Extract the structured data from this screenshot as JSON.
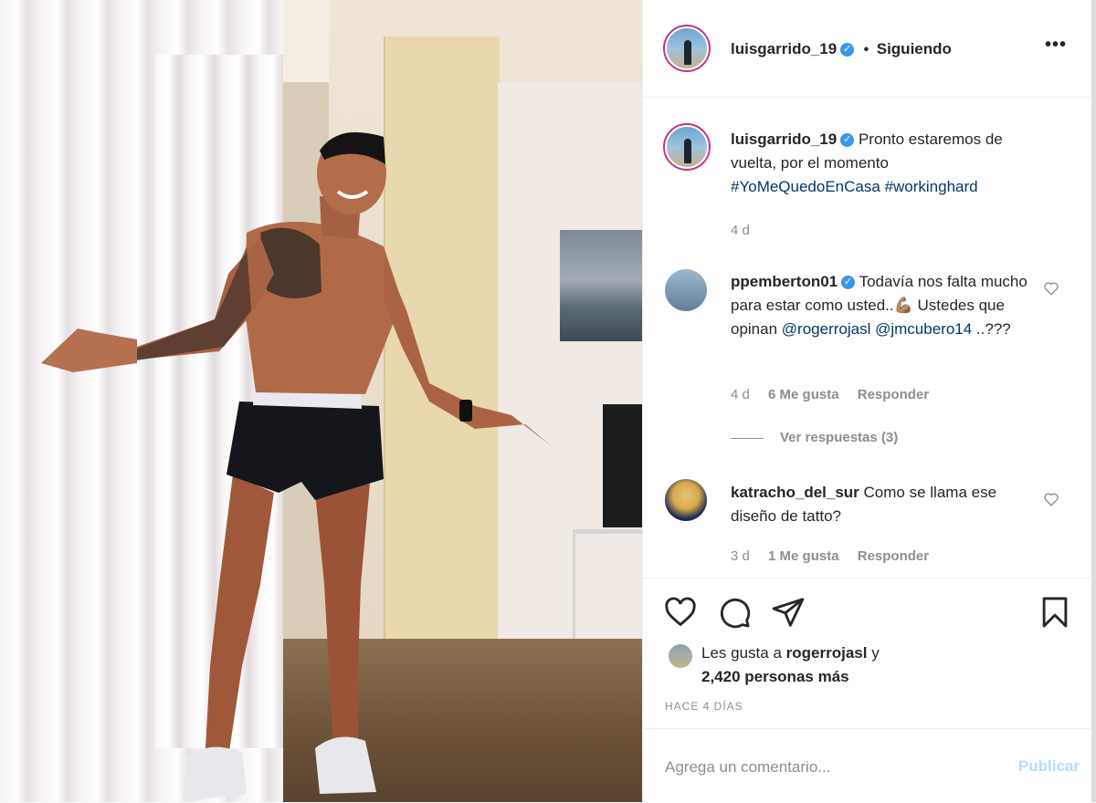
{
  "header": {
    "username": "luisgarrido_19",
    "separator": "•",
    "follow_status": "Siguiendo",
    "more_icon": "more-options-icon"
  },
  "caption": {
    "username": "luisgarrido_19",
    "text": "Pronto estaremos de vuelta, por el momento",
    "hashtags": [
      "#YoMeQuedoEnCasa",
      "#workinghard"
    ],
    "time": "4 d"
  },
  "comments": [
    {
      "username": "ppemberton01",
      "verified": true,
      "text_start": "Todavía nos falta mucho para estar como usted..",
      "emoji": "💪🏽",
      "text_end": " Ustedes que opinan",
      "mentions": [
        "@rogerrojasl",
        "@jmcubero14"
      ],
      "text_tail": " ..???",
      "time": "4 d",
      "likes": "6 Me gusta",
      "reply": "Responder",
      "view_replies": "Ver respuestas (3)"
    },
    {
      "username": "katracho_del_sur",
      "verified": false,
      "text": "Como se llama ese diseño de tatto?",
      "time": "3 d",
      "likes": "1 Me gusta",
      "reply": "Responder"
    }
  ],
  "actions": {
    "like_icon": "heart-icon",
    "comment_icon": "comment-icon",
    "share_icon": "share-icon",
    "save_icon": "bookmark-icon"
  },
  "likes": {
    "prefix": "Les gusta a",
    "user": "rogerrojasl",
    "conj": "y",
    "count_text": "2,420 personas más"
  },
  "timestamp": "HACE 4 DÍAS",
  "add_comment": {
    "placeholder": "Agrega un comentario...",
    "publish_label": "Publicar"
  },
  "colors": {
    "link": "#00376b",
    "verified": "#3897f0",
    "muted": "#8e8e8e",
    "publish_disabled": "#b2dffc"
  }
}
